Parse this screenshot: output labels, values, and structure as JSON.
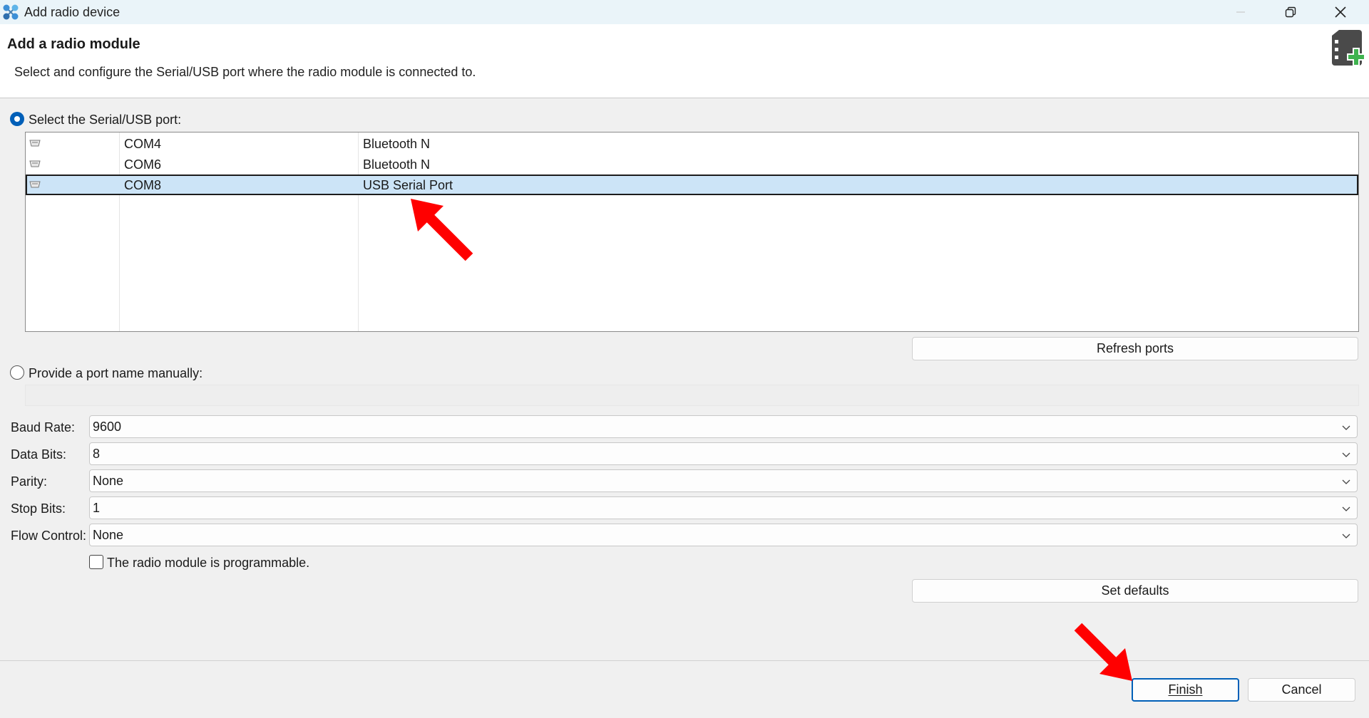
{
  "window": {
    "title": "Add radio device",
    "app_icon": "network-nodes-icon",
    "controls": [
      "minimize-icon",
      "restore-icon",
      "close-icon"
    ]
  },
  "header": {
    "title": "Add a radio module",
    "description": "Select and configure the Serial/USB port where the radio module is connected to.",
    "icon": "radio-module-add-icon"
  },
  "port_select": {
    "radio_label": "Select the Serial/USB port:",
    "selected": true,
    "rows": [
      {
        "port": "COM4",
        "description": "Bluetooth N",
        "icon": "serial-port-icon",
        "selected": false
      },
      {
        "port": "COM6",
        "description": "Bluetooth N",
        "icon": "serial-port-icon",
        "selected": false
      },
      {
        "port": "COM8",
        "description": "USB Serial Port",
        "icon": "serial-port-icon",
        "selected": true
      }
    ],
    "refresh_label": "Refresh ports"
  },
  "manual_port": {
    "radio_label": "Provide a port name manually:",
    "selected": false,
    "value": ""
  },
  "settings": {
    "baud_rate": {
      "label": "Baud Rate:",
      "value": "9600"
    },
    "data_bits": {
      "label": "Data Bits:",
      "value": "8"
    },
    "parity": {
      "label": "Parity:",
      "value": "None"
    },
    "stop_bits": {
      "label": "Stop Bits:",
      "value": "1"
    },
    "flow_control": {
      "label": "Flow Control:",
      "value": "None"
    },
    "programmable": {
      "label": "The radio module is programmable.",
      "checked": false
    },
    "defaults_label": "Set defaults"
  },
  "footer": {
    "finish_label": "Finish",
    "cancel_label": "Cancel"
  },
  "colors": {
    "accent": "#005fb8",
    "selection": "#cce4f7",
    "annotation_arrow": "#ff0000",
    "add_badge": "#3fb34f"
  }
}
